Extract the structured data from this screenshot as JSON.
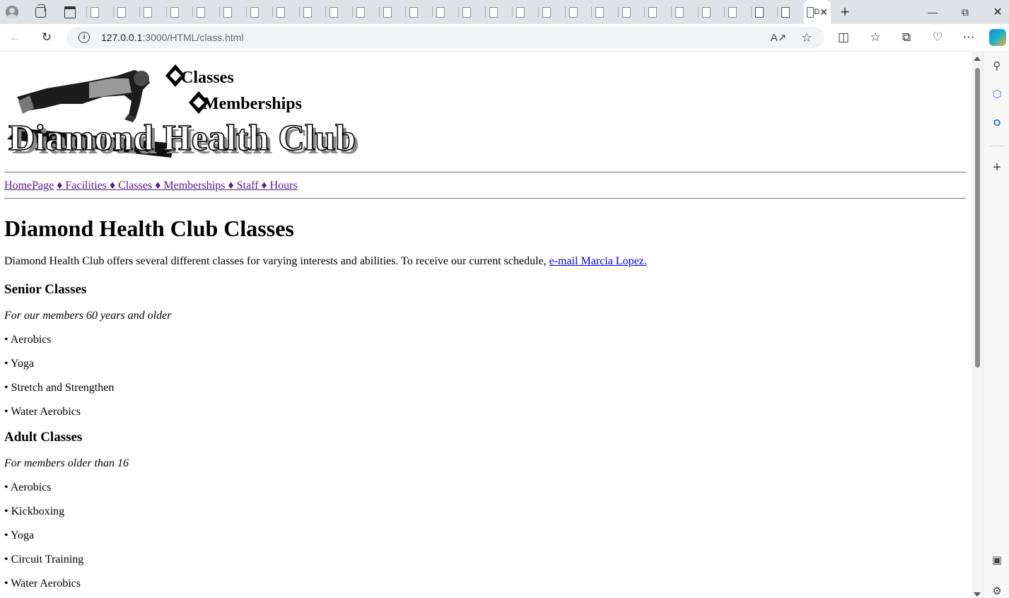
{
  "browser": {
    "active_tab_title": "D",
    "url_host": "127.0.0.1",
    "url_rest": ":3000/HTML/class.html",
    "background_tab_count": 27
  },
  "banner": {
    "line1": "Classes",
    "line2": "Memberships",
    "title": "Diamond Health Club"
  },
  "nav": {
    "home": "HomePage",
    "items": [
      "♦ Facilities ",
      "♦ Classes ",
      "♦ Memberships ",
      "♦ Staff ",
      "♦ Hours"
    ]
  },
  "page": {
    "heading": "Diamond Health Club Classes",
    "intro": "Diamond Health Club offers several different classes for varying interests and abilities. To receive our current schedule, ",
    "email_link": "e-mail Marcia Lopez."
  },
  "sections": [
    {
      "title": "Senior Classes",
      "subtitle": "For our members 60 years and older",
      "items": [
        "• Aerobics",
        "• Yoga",
        "• Stretch and Strengthen",
        "• Water Aerobics"
      ]
    },
    {
      "title": "Adult Classes",
      "subtitle": "For members older than 16",
      "items": [
        "• Aerobics",
        "• Kickboxing",
        "• Yoga",
        "• Circuit Training",
        "• Water Aerobics"
      ]
    }
  ]
}
